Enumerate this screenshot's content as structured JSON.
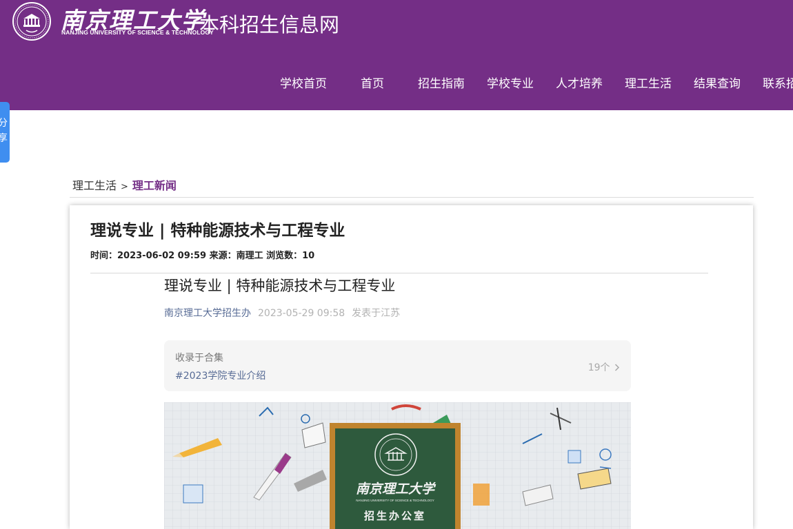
{
  "header": {
    "university_cn": "南京理工大学",
    "university_en": "NANJING UNIVERSITY OF SCIENCE & TECHNOLOGY",
    "site_name": "本科招生信息网",
    "logo": "university-seal-icon",
    "background": "#742e86"
  },
  "nav": {
    "items": [
      {
        "label": "学校首页"
      },
      {
        "label": "首页"
      },
      {
        "label": "招生指南"
      },
      {
        "label": "学校专业"
      },
      {
        "label": "人才培养"
      },
      {
        "label": "理工生活"
      },
      {
        "label": "结果查询"
      },
      {
        "label": "联系招"
      }
    ]
  },
  "share": {
    "line1": "分",
    "line2": "享",
    "color": "#3f8ef0"
  },
  "breadcrumb": {
    "parent": "理工生活",
    "separator": ">",
    "current": "理工新闻"
  },
  "article": {
    "title": "理说专业 | 特种能源技术与工程专业",
    "meta": "时间：2023-06-02 09:59 来源：南理工 浏览数：10"
  },
  "wechat": {
    "title": "理说专业 | 特种能源技术与工程专业",
    "author": "南京理工大学招生办",
    "date": "2023-05-29 09:58",
    "location": "发表于江苏",
    "album_label": "收录于合集",
    "album_tag": "#2023学院专业介绍",
    "album_count": "19个",
    "album_icon": "chevron-right-icon"
  },
  "cover": {
    "seal_text": "南京理工大学",
    "seal_en": "NANJING UNIVERSITY OF SCIENCE & TECHNOLOGY",
    "board_text": "招生办公室"
  }
}
